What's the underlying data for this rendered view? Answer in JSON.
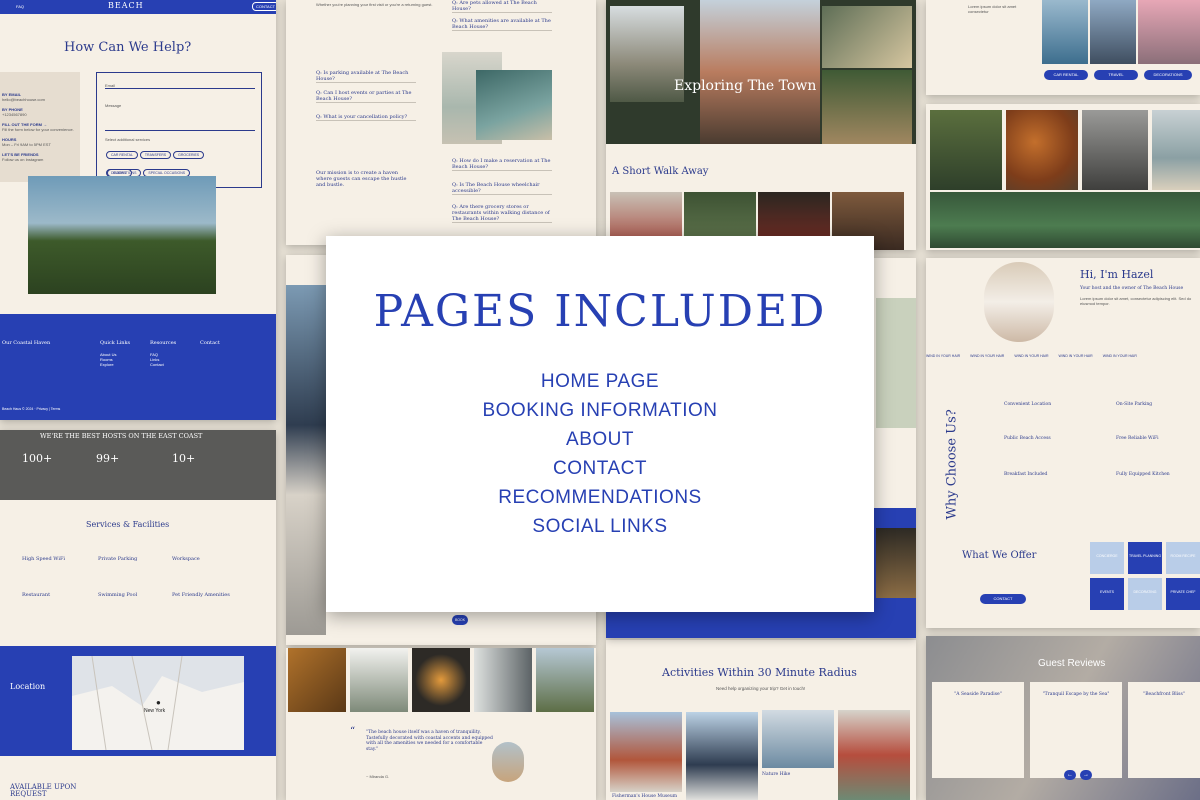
{
  "hero": {
    "title": "PAGES INCLUDED",
    "items": [
      "HOME PAGE",
      "BOOKING INFORMATION",
      "ABOUT",
      "CONTACT",
      "RECOMMENDATIONS",
      "SOCIAL LINKS"
    ]
  },
  "contact_page": {
    "logo": "BEACH",
    "nav_faq": "FAQ",
    "nav_contact": "CONTACT",
    "heading": "How Can We Help?",
    "by_email": "BY EMAIL",
    "by_phone": "BY PHONE",
    "fill_form": "FILL OUT THE FORM →",
    "hours": "HOURS",
    "lets_be_friends": "LET'S BE FRIENDS",
    "email_label": "Email",
    "message_label": "Message",
    "services_label": "Select additional services",
    "services": [
      "CAR RENTAL",
      "TRANSFERS",
      "GROCERIES",
      "DECORATIONS",
      "SPECIAL OCCASIONS",
      "TRAVEL PLANNING"
    ],
    "submit": "SUBMIT"
  },
  "footer": {
    "col1": "Our Coastal Haven",
    "col2": "Quick Links",
    "col3": "Resources",
    "col4": "Contact",
    "links": [
      "About Us",
      "Rooms",
      "Explore"
    ],
    "resources": [
      "FAQ",
      "Links",
      "Contact"
    ],
    "copyright": "Beach Haus © 2024 · Privacy | Terms"
  },
  "stats": {
    "heading": "WE'RE THE BEST HOSTS ON THE EAST COAST",
    "values": [
      "100+",
      "99+",
      "10+"
    ]
  },
  "services": {
    "heading": "Services & Facilities",
    "items": [
      "High Speed WiFi",
      "Private Parking",
      "Workspace",
      "Restaurant",
      "Swimming Pool",
      "Pet Friendly Amenities"
    ]
  },
  "location": {
    "heading": "Location",
    "city": "New York",
    "available": "AVAILABLE UPON REQUEST"
  },
  "faq": {
    "left": [
      "Q: Is parking available at The Beach House?",
      "Q: Can I host events or parties at The Beach House?",
      "Q: What is your cancellation policy?"
    ],
    "right": [
      "Q: Are pets allowed at The Beach House?",
      "Q: What amenities are available at The Beach House?",
      "Q: How do I make a reservation at The Beach House?",
      "Q: Is The Beach House wheelchair accessible?",
      "Q: Are there grocery stores or restaurants within walking distance of The Beach House?"
    ],
    "mission": "Our mission is to create a haven where guests can escape the hustle and bustle."
  },
  "town": {
    "title": "Exploring The Town",
    "short_walk": "A Short Walk Away",
    "activities": "Activities Within 30 Minute Radius",
    "activities_sub": "Need help organizing your trip? Get in touch!",
    "captions": [
      "Fisherman's House Museum",
      "Nature Hike"
    ]
  },
  "gallery": {
    "buttons": [
      "CAR RENTAL",
      "TRAVEL",
      "DECORATIONS"
    ]
  },
  "about": {
    "greeting": "Hi, I'm Hazel",
    "subtitle": "Your host and the owner of The Beach House",
    "ticker": "WIND IN YOUR HAIR",
    "why": "Why Choose Us?",
    "features": [
      "Convenient Location",
      "On-Site Parking",
      "Public Beach Access",
      "Free Reliable WiFi",
      "Breakfast Included",
      "Fully Equipped Kitchen"
    ],
    "offer": "What We Offer",
    "offer_btn": "CONTACT",
    "tiles": [
      "CONCIERGE",
      "TRAVEL PLANNING",
      "ROOM RECIPE",
      "EVENTS",
      "DECORATING",
      "PRIVATE CHEF"
    ]
  },
  "reviews": {
    "heading": "Guest Reviews",
    "titles": [
      "\"A Seaside Paradise\"",
      "\"Tranquil Escape by the Sea\"",
      "\"Beachfront Bliss\""
    ]
  },
  "quote": {
    "text": "\"The beach house itself was a haven of tranquility. Tastefully decorated with coastal accents and equipped with all the amenities we needed for a comfortable stay.\"",
    "author": "~ Miranda G."
  },
  "colors": {
    "brand": "#2740b3",
    "paper": "#f6f0e6"
  }
}
